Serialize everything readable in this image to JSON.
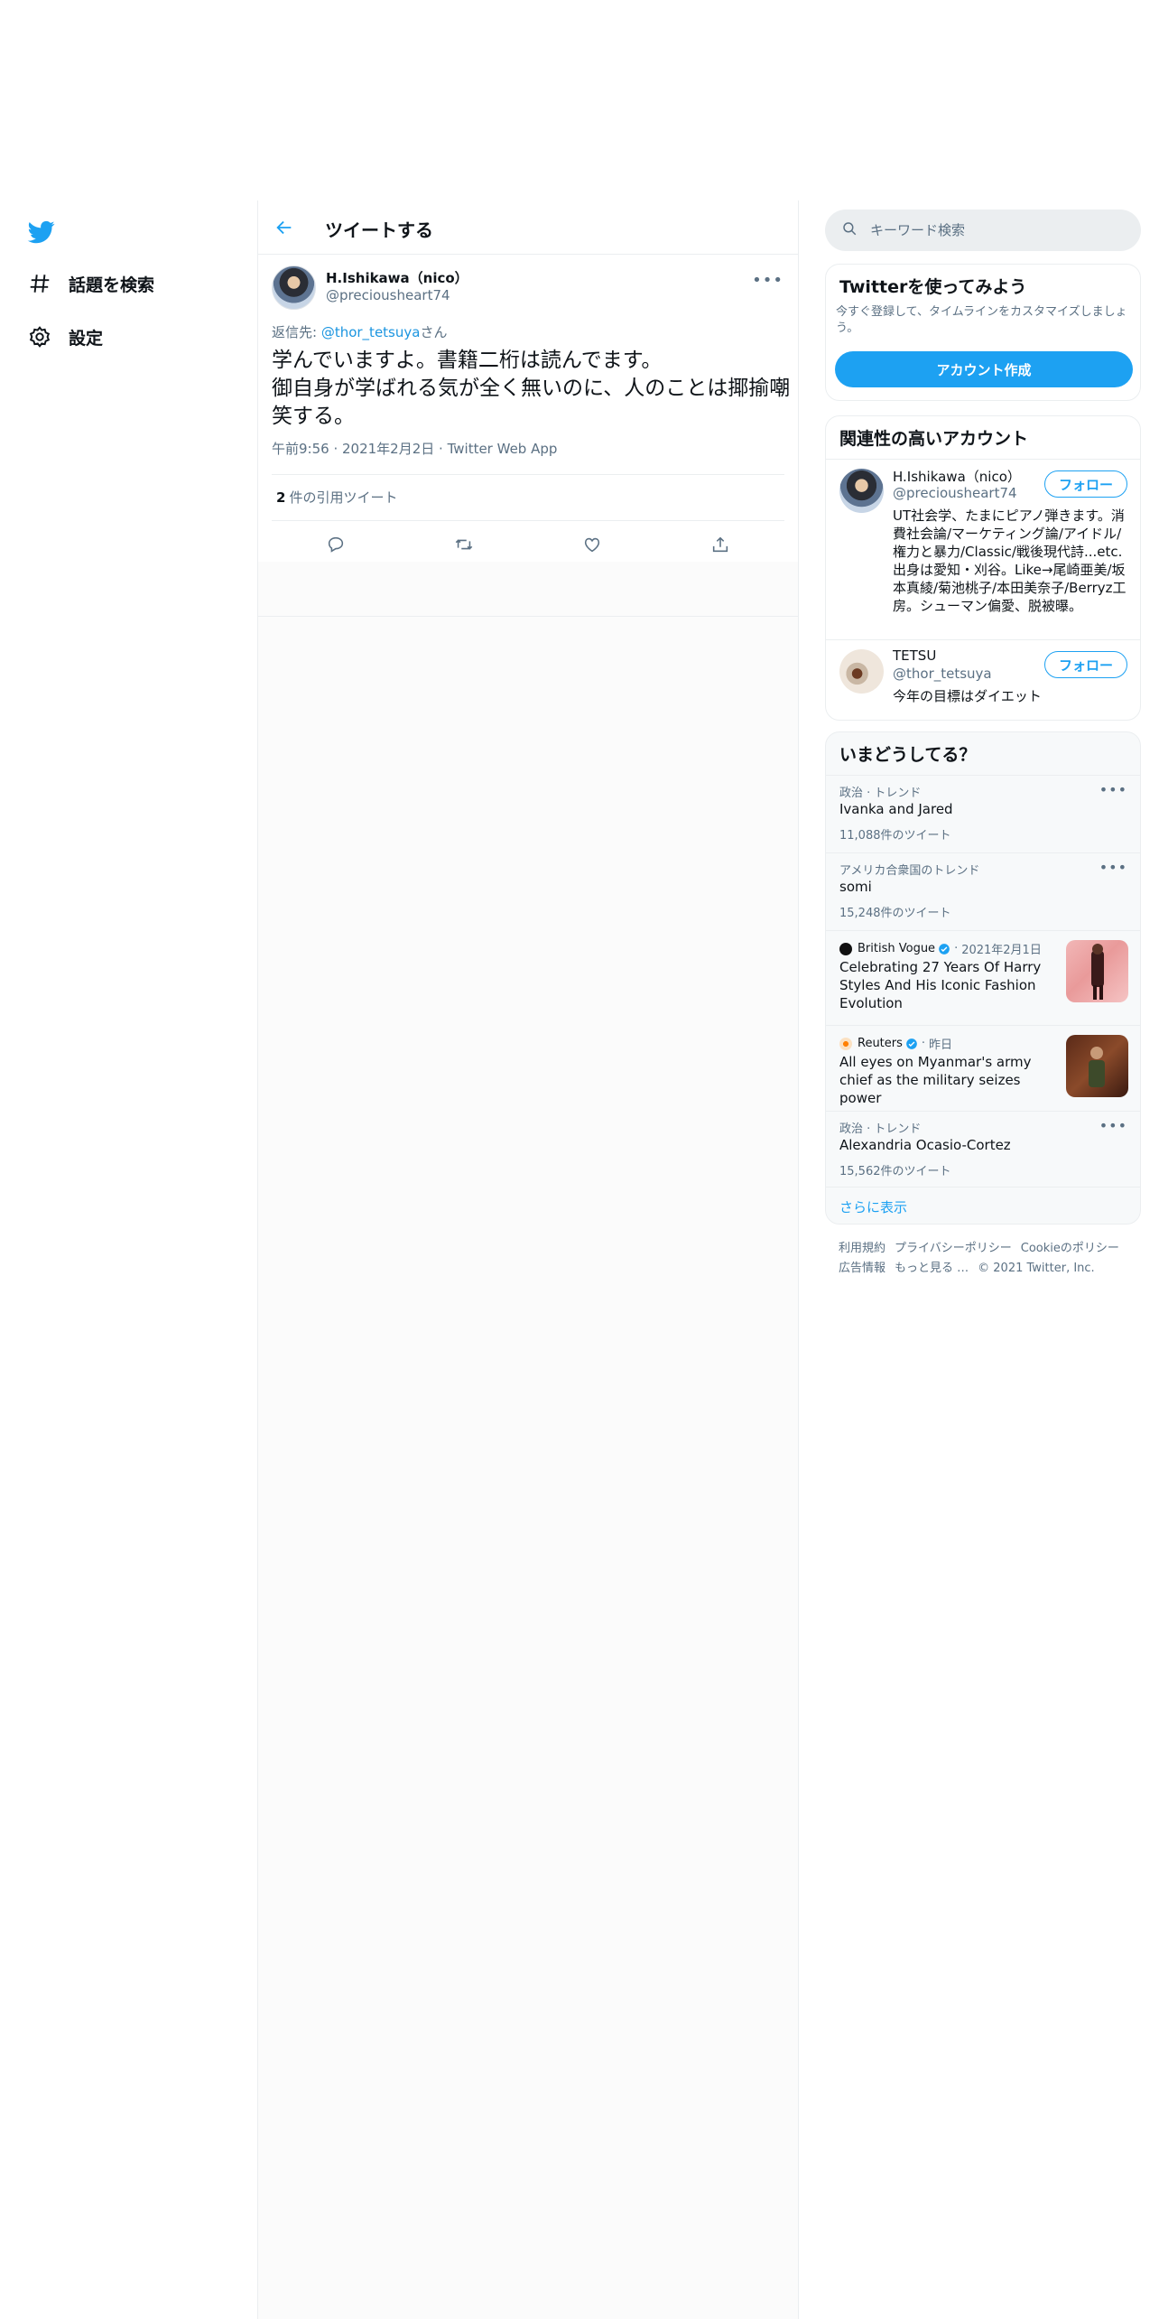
{
  "nav": {
    "items": [
      {
        "label": "話題を検索",
        "icon": "hashtag-icon"
      },
      {
        "label": "設定",
        "icon": "gear-icon"
      }
    ]
  },
  "header": {
    "title": "ツイートする"
  },
  "tweet": {
    "name": "H.Ishikawa（nico）",
    "handle": "@preciousheart74",
    "reply_prefix": "返信先: ",
    "reply_mention": "@thor_tetsuya",
    "reply_suffix": "さん",
    "text_line1": "学んでいますよ。書籍二桁は読んでます。",
    "text_line2": "御自身が学ばれる気が全く無いのに、人のことは揶揄嘲笑する。",
    "time": "午前9:56",
    "date": "2021年2月2日",
    "source": "Twitter Web App",
    "quote_count": "2",
    "quote_label": "件の引用ツイート"
  },
  "search": {
    "placeholder": "キーワード検索"
  },
  "signup": {
    "title": "Twitterを使ってみよう",
    "desc": "今すぐ登録して、タイムラインをカスタマイズしましょう。",
    "button": "アカウント作成"
  },
  "related": {
    "title": "関連性の高いアカウント",
    "follow_label": "フォロー",
    "accounts": [
      {
        "name": "H.Ishikawa（nico）",
        "handle": "@preciousheart74",
        "bio": "UT社会学、たまにピアノ弾きます。消費社会論/マーケティング論/アイドル/権力と暴力/Classic/戦後現代詩...etc. 出身は愛知・刈谷。Like→尾崎亜美/坂本真綾/菊池桃子/本田美奈子/Berryz工房。シューマン偏愛、脱被曝。"
      },
      {
        "name": "TETSU",
        "handle": "@thor_tetsuya",
        "bio": "今年の目標はダイエット"
      }
    ]
  },
  "trends": {
    "title": "いまどうしてる？",
    "items": [
      {
        "context": "政治 · トレンド",
        "name": "Ivanka and Jared",
        "count": "11,088件のツイート"
      },
      {
        "context": "アメリカ合衆国のトレンド",
        "name": "somi",
        "count": "15,248件のツイート"
      },
      {
        "source": "British Vogue",
        "date": "2021年2月1日",
        "headline": "Celebrating 27 Years Of Harry Styles And His Iconic Fashion Evolution"
      },
      {
        "source": "Reuters",
        "date": "昨日",
        "headline": "All eyes on Myanmar's army chief as the military seizes power"
      },
      {
        "context": "政治 · トレンド",
        "name": "Alexandria Ocasio-Cortez",
        "count": "15,562件のツイート"
      }
    ],
    "show_more": "さらに表示"
  },
  "footer": {
    "links": [
      "利用規約",
      "プライバシーポリシー",
      "Cookieのポリシー",
      "広告情報",
      "もっと見る …",
      "© 2021 Twitter, Inc."
    ]
  },
  "colors": {
    "accent": "#1da1f2",
    "text": "#0f1419",
    "muted": "#5b7083",
    "border": "#ebeef0"
  }
}
